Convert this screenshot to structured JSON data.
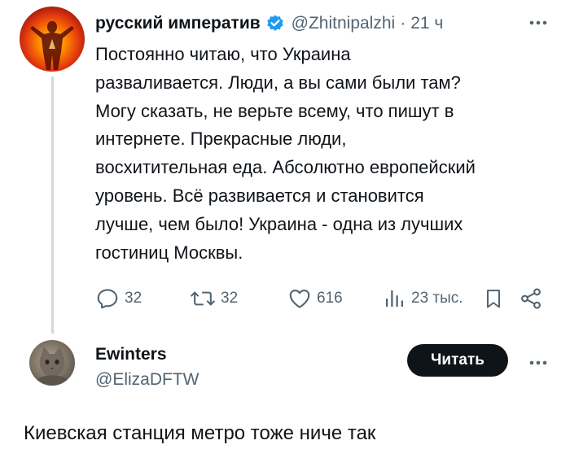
{
  "tweet": {
    "author": {
      "display_name": "русский императив",
      "handle": "@Zhitnipalzhi",
      "time": "21 ч",
      "verified": true
    },
    "separator": "·",
    "text": "Постоянно читаю, что Украина\nразваливается. Люди, а вы сами были там?\nМогу сказать, не верьте всему, что пишут в\nинтернете. Прекрасные люди,\nвосхитительная еда. Абсолютно европейский\nуровень. Всё развивается и становится\nлучше, чем было! Украина - одна из лучших\nгостиниц Москвы.",
    "stats": {
      "replies": "32",
      "retweets": "32",
      "likes": "616",
      "views": "23 тыс."
    }
  },
  "user_card": {
    "display_name": "Ewinters",
    "handle": "@ElizaDFTW",
    "follow_label": "Читать",
    "bio": "Киевская станция метро тоже ниче так"
  },
  "colors": {
    "text": "#0f1419",
    "secondary": "#536471",
    "verified_blue": "#1d9bf0",
    "follow_bg": "#0f1419",
    "thread_line": "#cfd9de"
  }
}
